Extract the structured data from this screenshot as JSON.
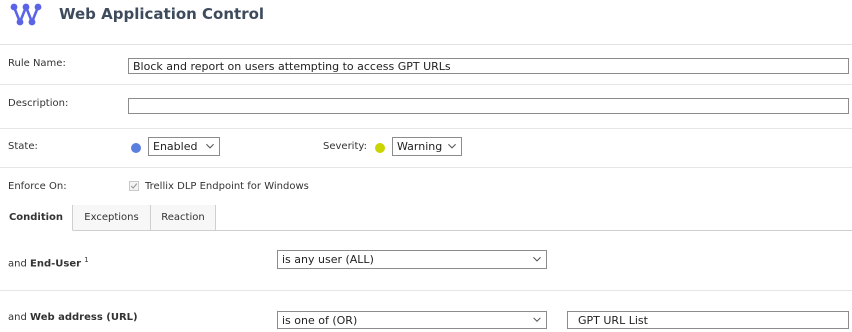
{
  "app": {
    "title": "Web Application Control"
  },
  "form": {
    "rule_name": {
      "label": "Rule Name:",
      "value": "Block and report on users attempting to access GPT URLs"
    },
    "description": {
      "label": "Description:",
      "value": ""
    },
    "state": {
      "label": "State:",
      "value": "Enabled",
      "dot_color": "#5b7fe0"
    },
    "severity": {
      "label": "Severity:",
      "value": "Warning",
      "dot_color": "#c9d400"
    },
    "enforce_on": {
      "label": "Enforce On:",
      "option": "Trellix DLP Endpoint for Windows",
      "checked": true
    }
  },
  "tabs": [
    {
      "label": "Condition",
      "active": true
    },
    {
      "label": "Exceptions",
      "active": false
    },
    {
      "label": "Reaction",
      "active": false
    }
  ],
  "conditions": [
    {
      "prefix": "and",
      "field": "End-User",
      "sup": "1",
      "operator": "is any user (ALL)",
      "value": ""
    },
    {
      "prefix": "and",
      "field": "Web address (URL)",
      "sup": "",
      "operator": "is one of (OR)",
      "value": "GPT URL List"
    }
  ]
}
